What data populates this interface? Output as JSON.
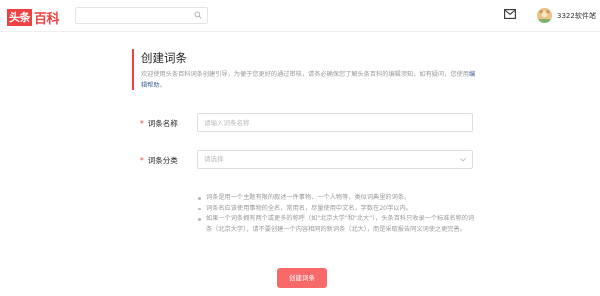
{
  "header": {
    "logo_mark": "头条",
    "logo_text": "百科",
    "search_placeholder": "",
    "username": "3322软件站"
  },
  "form": {
    "title": "创建词条",
    "intro": "欢迎使用头条百科词条创建引导，为便于您更好的通过审核，请务必确保您了解头条百科的编辑须知，如有疑问，您使用",
    "help_link": "编辑帮助",
    "intro_end": "。",
    "name_required_mark": "*",
    "name_label": "词条名称",
    "name_placeholder": "请输入词条名称",
    "category_required_mark": "*",
    "category_label": "词条分类",
    "category_placeholder": "请选择",
    "notes": [
      "词条是用一个主题有限的叙述一件事物、一个人物等，类似词典里的词条。",
      "词条名应该使用事物的全名，常用名，尽量使用中文名，字数在20字以内。",
      "如果一个词条拥有两个或更多的称呼（如\"北京大学\"和\"北大\"），头条百科只收录一个标准名称的词条（北京大学），请不要创建一个内容相同的新词条（北大），而是采取报告同义词使之更完善。"
    ],
    "submit_label": "创建词条"
  },
  "colors": {
    "brand": "#f04142",
    "submit": "#f8696a",
    "link": "#406599"
  }
}
